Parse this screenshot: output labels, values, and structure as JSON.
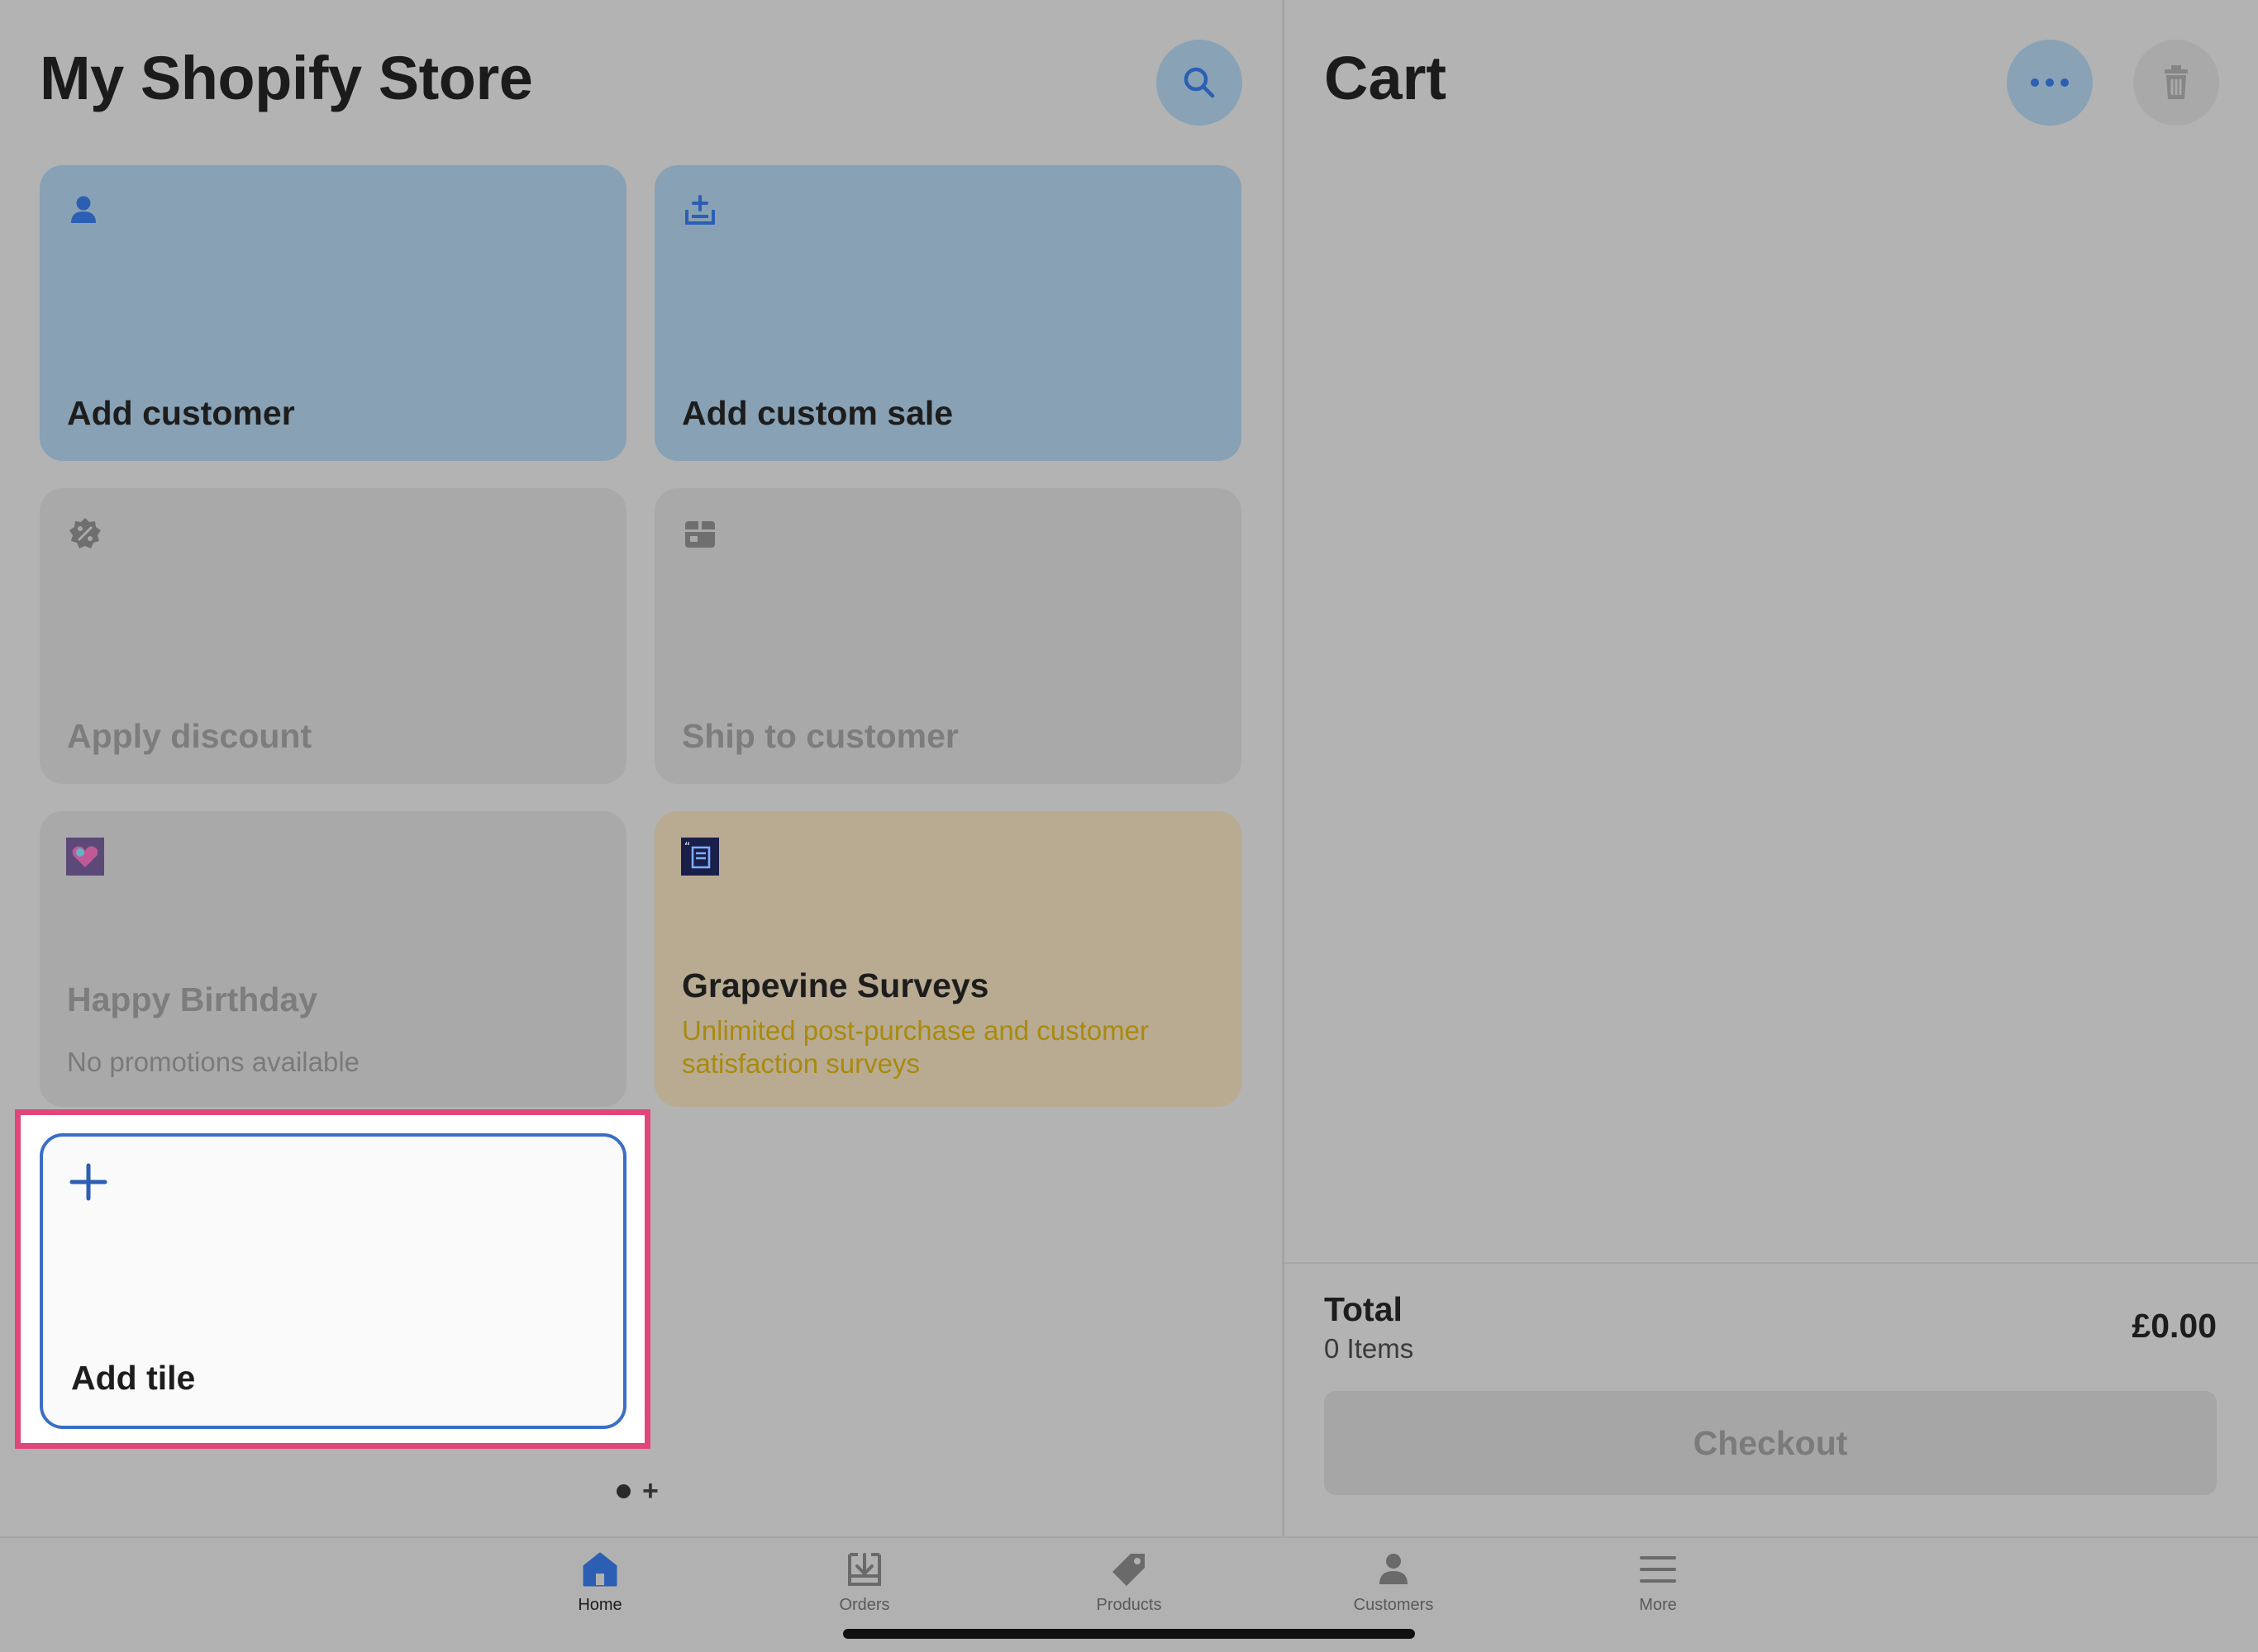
{
  "store": {
    "title": "My Shopify Store"
  },
  "tiles": [
    {
      "label": "Add customer",
      "icon": "person-icon"
    },
    {
      "label": "Add custom sale",
      "icon": "custom-sale-icon"
    },
    {
      "label": "Apply discount",
      "icon": "discount-badge-icon"
    },
    {
      "label": "Ship to customer",
      "icon": "shipping-box-icon"
    },
    {
      "label": "Happy Birthday",
      "sublabel": "No promotions available",
      "icon": "app-heart-icon"
    },
    {
      "label": "Grapevine Surveys",
      "sublabel": "Unlimited post-purchase and customer satisfaction surveys",
      "icon": "app-survey-icon"
    }
  ],
  "add_tile": {
    "label": "Add tile"
  },
  "pager": {
    "add_page": "+"
  },
  "cart": {
    "title": "Cart",
    "total_label": "Total",
    "items": "0 Items",
    "total_value": "£0.00",
    "checkout_label": "Checkout"
  },
  "tabbar": {
    "items": [
      {
        "label": "Home",
        "icon": "home-icon",
        "active": true
      },
      {
        "label": "Orders",
        "icon": "orders-icon",
        "active": false
      },
      {
        "label": "Products",
        "icon": "tag-icon",
        "active": false
      },
      {
        "label": "Customers",
        "icon": "person-icon",
        "active": false
      },
      {
        "label": "More",
        "icon": "hamburger-icon",
        "active": false
      }
    ]
  },
  "colors": {
    "accent_blue": "#2c5fb3",
    "highlight_pink": "#e0467c",
    "survey_gold": "#a98a0e"
  }
}
